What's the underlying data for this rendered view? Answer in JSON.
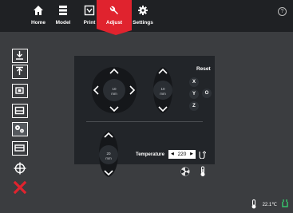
{
  "nav": {
    "tabs": [
      {
        "label": "Home",
        "icon": "home-icon"
      },
      {
        "label": "Model",
        "icon": "model-icon"
      },
      {
        "label": "Print",
        "icon": "print-icon"
      },
      {
        "label": "Adjust",
        "icon": "wrench-icon",
        "active": true
      },
      {
        "label": "Settings",
        "icon": "gear-icon"
      }
    ],
    "help_symbol": "?"
  },
  "sidebar": {
    "buttons": [
      "download-icon",
      "upload-icon",
      "frame-icon",
      "layer-icon",
      "gears-icon",
      "calibration-icon",
      "crosshair-icon",
      "close-icon"
    ]
  },
  "jog": {
    "xy_step": "10",
    "xy_unit": "mm",
    "z_step": "10",
    "z_unit": "mm",
    "e_step": "20",
    "e_unit": "mm",
    "reset_label": "Reset",
    "axes": [
      "X",
      "Y",
      "Z"
    ],
    "all_axes_label": "O"
  },
  "temperature": {
    "label": "Temperature",
    "value": "220",
    "decrease_symbol": "◀",
    "increase_symbol": "▶"
  },
  "status": {
    "temperature": "22.1℃"
  },
  "colors": {
    "accent": "#e0232e",
    "background": "#3b3d40",
    "topbar": "#1f2124",
    "panel": "#222529",
    "close": "#e0232e",
    "status_ok": "#36c36b"
  }
}
